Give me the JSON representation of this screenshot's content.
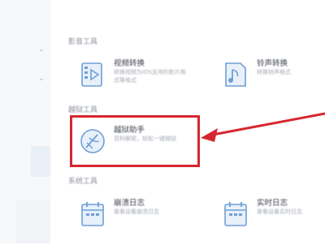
{
  "sidebar": {
    "items": [
      {
        "icon": "chevron-down-icon",
        "glyph": "⌄"
      },
      {
        "icon": "chevron-down-icon",
        "glyph": "⌄"
      }
    ]
  },
  "sections": [
    {
      "title": "影音工具",
      "tools": [
        {
          "name": "视频转换",
          "desc_lines": [
            "转换视频为iOS支持的影片格",
            "式等格式"
          ],
          "icon": "video-convert-icon"
        },
        {
          "name": "铃声转换",
          "desc_lines": [
            "转换铃声格式"
          ],
          "icon": "ringtone-convert-icon"
        }
      ]
    },
    {
      "title": "越狱工具",
      "tools": [
        {
          "name": "越狱助手",
          "desc_lines": [
            "百科解密，轻松一键越狱"
          ],
          "icon": "jailbreak-helper-icon",
          "highlighted": true
        }
      ]
    },
    {
      "title": "系统工具",
      "tools": [
        {
          "name": "崩溃日志",
          "desc_lines": [
            "查看设备崩溃日志"
          ],
          "icon": "crash-log-icon"
        },
        {
          "name": "实时日志",
          "desc_lines": [
            "查看设备实时日志"
          ],
          "icon": "realtime-log-icon"
        }
      ]
    }
  ],
  "colors": {
    "highlight": "#d6262f",
    "icon": "#6f9fd6",
    "icon_fill": "#e8f0fa"
  }
}
